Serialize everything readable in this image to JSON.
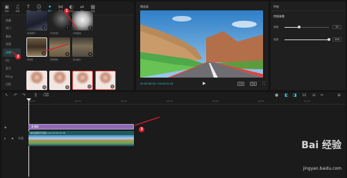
{
  "toolbar": {
    "tools": [
      {
        "icon": "import-icon",
        "glyph": "▣",
        "label": "媒体"
      },
      {
        "icon": "audio-icon",
        "glyph": "♫",
        "label": "音频"
      },
      {
        "icon": "text-icon",
        "glyph": "T",
        "label": "文本"
      },
      {
        "icon": "sticker-icon",
        "glyph": "☺",
        "label": "贴纸"
      },
      {
        "icon": "effects-icon",
        "glyph": "✦",
        "label": "特效"
      },
      {
        "icon": "transition-icon",
        "glyph": "⋈",
        "label": "转场"
      },
      {
        "icon": "filter-icon",
        "glyph": "◐",
        "label": "滤镜"
      },
      {
        "icon": "adjust-icon",
        "glyph": "⇌",
        "label": "调节"
      },
      {
        "icon": "template-icon",
        "glyph": "▦",
        "label": "模板"
      }
    ]
  },
  "categories": [
    "收藏",
    "热门",
    "基础",
    "氛围",
    "动感",
    "DV",
    "复古",
    "Bling",
    "边框"
  ],
  "active_category": 4,
  "effect_items": [
    {
      "label": "泡泡爆开"
    },
    {
      "label": "闪光特效"
    },
    {
      "label": "分屏变焦"
    },
    {
      "label": "老电影"
    },
    {
      "label": "纸质颗粒"
    },
    {
      "label": "复古胶片"
    },
    {
      "label": "人像"
    },
    {
      "label": "人像"
    },
    {
      "label": "人像"
    },
    {
      "label": "人像"
    }
  ],
  "badges": {
    "b1": "1",
    "b2": "2",
    "b3": "3"
  },
  "preview": {
    "title": "播放器",
    "time": "00:00:00:00 / 00:00:22:18",
    "btn_ratio": "比例",
    "btn_original": "原始"
  },
  "properties": {
    "title": "特效",
    "subtitle": "特效参数",
    "params": [
      {
        "label": "速度",
        "value": "33",
        "level": 0.33
      },
      {
        "label": "强度",
        "value": "100",
        "level": 1.0
      }
    ]
  },
  "timeline": {
    "ticks": [
      "00:00",
      "00:10",
      "00:20",
      "00:30",
      "00:40",
      "00:50",
      "01:00"
    ],
    "effect_clip": "老电影",
    "video_clip": "城市道路风景视频.mp4  00:00:22:18",
    "track_label": "封面"
  },
  "watermark": {
    "brand": "Bai 经验",
    "url": "jingyan.baidu.com"
  },
  "colors": {
    "accent": "#3ac7d8",
    "effect_clip": "#8e6ab5",
    "video_clip": "#1e5d5c",
    "badge": "#d81f2c"
  }
}
